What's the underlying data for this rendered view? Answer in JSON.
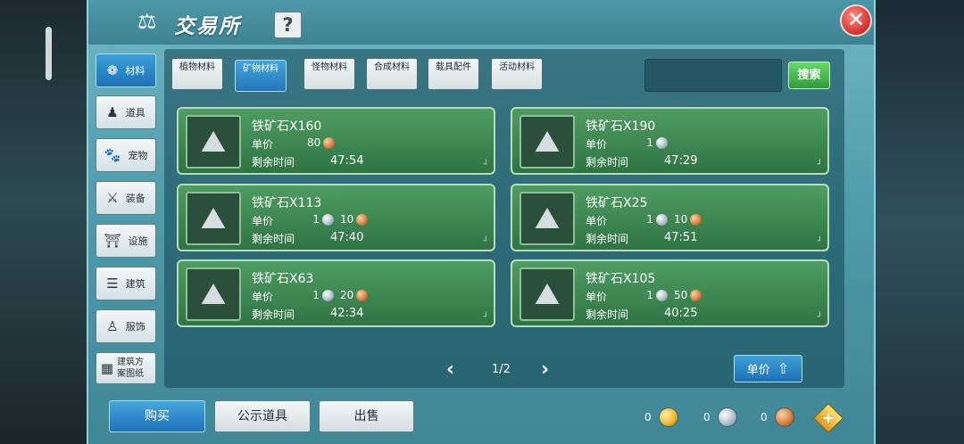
{
  "header": {
    "title": "交易所",
    "help_label": "?",
    "close_label": "✕"
  },
  "sidebar": {
    "items": [
      {
        "label": "材料",
        "icon": "materials-icon",
        "glyph": "❁"
      },
      {
        "label": "道具",
        "icon": "item-icon",
        "glyph": "♟"
      },
      {
        "label": "宠物",
        "icon": "pet-paw-icon",
        "glyph": "🐾"
      },
      {
        "label": "装备",
        "icon": "equipment-icon",
        "glyph": "⚔"
      },
      {
        "label": "设施",
        "icon": "facility-icon",
        "glyph": "⛩"
      },
      {
        "label": "建筑",
        "icon": "building-icon",
        "glyph": "☰"
      },
      {
        "label": "服饰",
        "icon": "clothing-icon",
        "glyph": "♙"
      },
      {
        "label": "建筑方案图纸",
        "icon": "blueprint-icon",
        "glyph": "▦"
      }
    ]
  },
  "tabs": [
    {
      "label": "植物材料"
    },
    {
      "label": "矿物材料"
    },
    {
      "label": "怪物材料"
    },
    {
      "label": "合成材料"
    },
    {
      "label": "载具配件"
    },
    {
      "label": "活动材料"
    }
  ],
  "search": {
    "placeholder": "",
    "button_label": "搜索"
  },
  "labels": {
    "price": "单价",
    "time": "剩余时间"
  },
  "listings": [
    {
      "name": "铁矿石X160",
      "silver": "",
      "copper": "80",
      "time": "47:54"
    },
    {
      "name": "铁矿石X190",
      "silver": "1",
      "copper": "",
      "time": "47:29"
    },
    {
      "name": "铁矿石X113",
      "silver": "1",
      "copper": "10",
      "time": "47:40"
    },
    {
      "name": "铁矿石X25",
      "silver": "1",
      "copper": "10",
      "time": "47:51"
    },
    {
      "name": "铁矿石X63",
      "silver": "1",
      "copper": "20",
      "time": "42:34"
    },
    {
      "name": "铁矿石X105",
      "silver": "1",
      "copper": "50",
      "time": "40:25"
    }
  ],
  "pager": {
    "text": "1/2",
    "prev": "‹",
    "next": "›"
  },
  "sort": {
    "label": "单价"
  },
  "bottom": {
    "buy": "购买",
    "public": "公示道具",
    "sell": "出售"
  },
  "currency": {
    "gold": "0",
    "silver": "0",
    "copper": "0"
  },
  "colors": {
    "accent_blue": "#1f72b7",
    "card_green": "#2f7444",
    "search_green": "#2e9b37",
    "close_red": "#e0403c"
  }
}
